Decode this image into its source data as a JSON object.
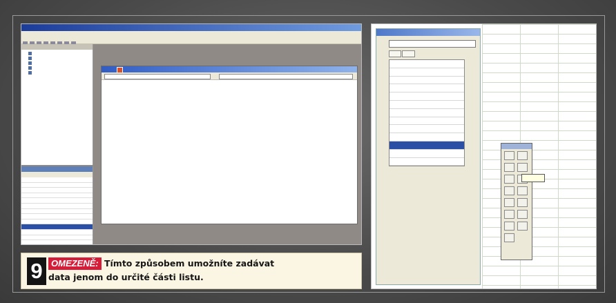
{
  "caption": {
    "number": "9",
    "label": "OMEZENĚ:",
    "line1": "Tímto způsobem umožníte zadávat",
    "line2": "data jenom do určité části listu."
  }
}
